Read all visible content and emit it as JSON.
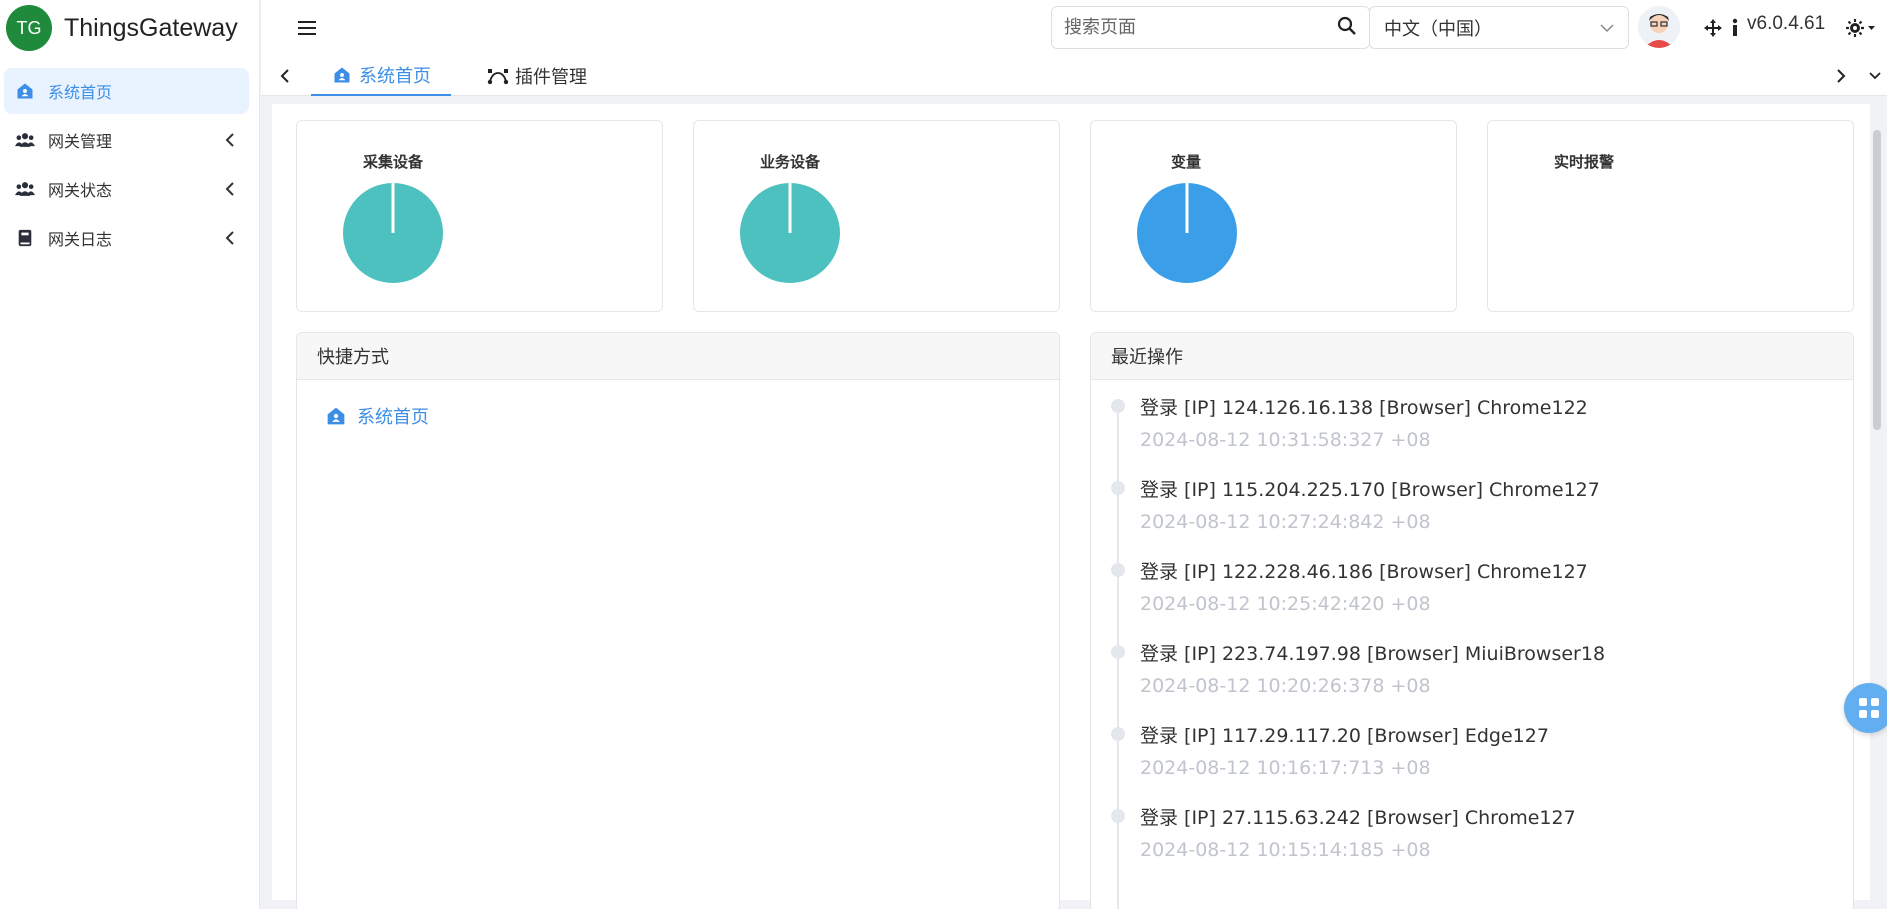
{
  "brand": {
    "logo_text": "TG",
    "name": "ThingsGateway"
  },
  "sidebar": {
    "items": [
      {
        "label": "系统首页",
        "icon": "home-icon",
        "active": true
      },
      {
        "label": "网关管理",
        "icon": "users-icon",
        "active": false
      },
      {
        "label": "网关状态",
        "icon": "users-icon",
        "active": false
      },
      {
        "label": "网关日志",
        "icon": "book-icon",
        "active": false
      }
    ]
  },
  "header": {
    "search_placeholder": "搜索页面",
    "language": "中文（中国）",
    "version": "v6.0.4.61"
  },
  "tabs": [
    {
      "label": "系统首页",
      "icon": "home-icon",
      "active": true
    },
    {
      "label": "插件管理",
      "icon": "bezier-icon",
      "active": false
    }
  ],
  "stats": [
    {
      "title": "采集设备",
      "color": "#4cc1bf"
    },
    {
      "title": "业务设备",
      "color": "#4cc1bf"
    },
    {
      "title": "变量",
      "color": "#3a9fe8"
    },
    {
      "title": "实时报警",
      "color": ""
    }
  ],
  "shortcuts": {
    "title": "快捷方式",
    "items": [
      {
        "label": "系统首页",
        "icon": "home-icon"
      }
    ]
  },
  "recent": {
    "title": "最近操作",
    "items": [
      {
        "text": "登录 [IP] 124.126.16.138 [Browser] Chrome122",
        "time": "2024-08-12 10:31:58:327 +08"
      },
      {
        "text": "登录 [IP] 115.204.225.170 [Browser] Chrome127",
        "time": "2024-08-12 10:27:24:842 +08"
      },
      {
        "text": "登录 [IP] 122.228.46.186 [Browser] Chrome127",
        "time": "2024-08-12 10:25:42:420 +08"
      },
      {
        "text": "登录 [IP] 223.74.197.98 [Browser] MiuiBrowser18",
        "time": "2024-08-12 10:20:26:378 +08"
      },
      {
        "text": "登录 [IP] 117.29.117.20 [Browser] Edge127",
        "time": "2024-08-12 10:16:17:713 +08"
      },
      {
        "text": "登录 [IP] 27.115.63.242 [Browser] Chrome127",
        "time": "2024-08-12 10:15:14:185 +08"
      }
    ]
  },
  "colors": {
    "accent": "#3d8ee7",
    "active_bg": "#e8f3ff",
    "teal": "#4cc1bf",
    "blue": "#3a9fe8"
  }
}
